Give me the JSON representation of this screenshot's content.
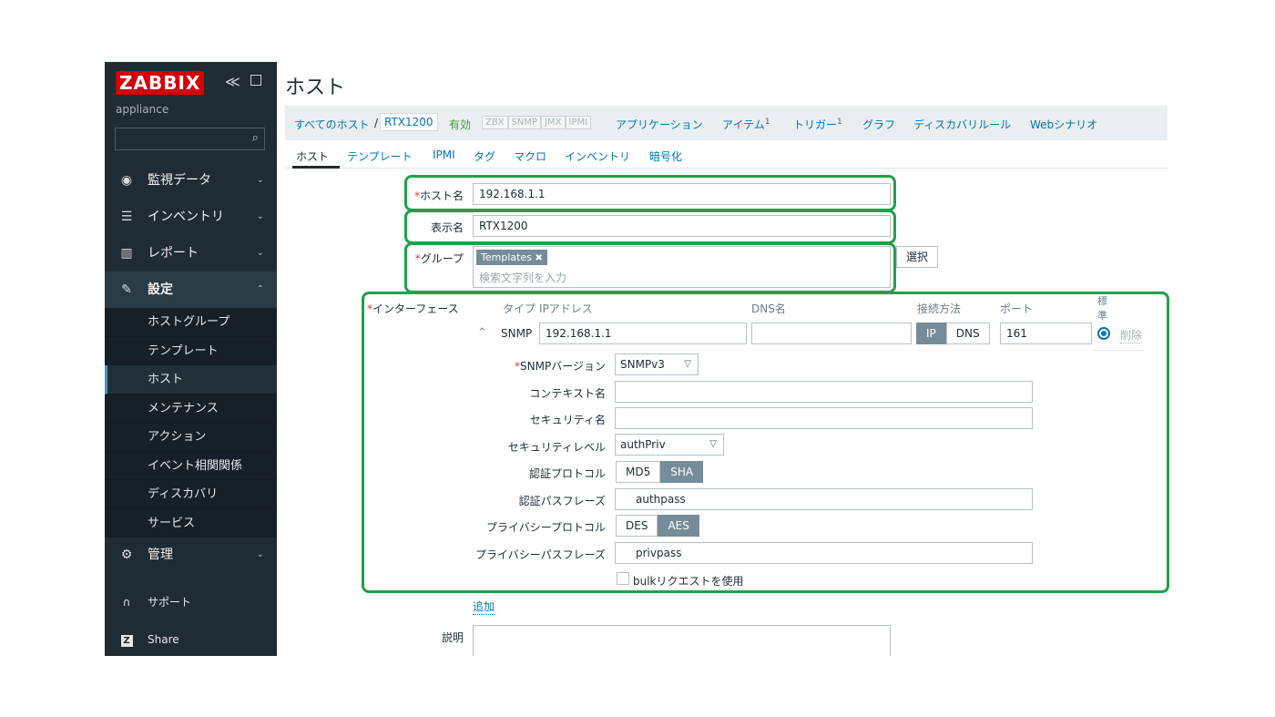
{
  "sidebar": {
    "logo": "ZABBIX",
    "collapse_icon": "≪",
    "server_name": "appliance",
    "menu": [
      {
        "label": "監視データ",
        "icon": "eye-icon"
      },
      {
        "label": "インベントリ",
        "icon": "list-icon"
      },
      {
        "label": "レポート",
        "icon": "bar-chart-icon"
      },
      {
        "label": "設定",
        "icon": "wrench-icon"
      },
      {
        "label": "管理",
        "icon": "gear-icon"
      }
    ],
    "config_items": [
      "ホストグループ",
      "テンプレート",
      "ホスト",
      "メンテナンス",
      "アクション",
      "イベント相関関係",
      "ディスカバリ",
      "サービス"
    ],
    "support": "サポート",
    "share": "Share",
    "share_badge": "Z"
  },
  "page": {
    "title": "ホスト"
  },
  "nav": {
    "all_hosts": "すべてのホスト",
    "separator": "/",
    "current_host": "RTX1200",
    "status": "有効",
    "availability": [
      "ZBX",
      "SNMP",
      "JMX",
      "IPMI"
    ],
    "links": [
      "アプリケーション",
      "アイテム",
      "トリガー",
      "グラフ",
      "ディスカバリルール",
      "Webシナリオ"
    ],
    "items_count": "1",
    "triggers_count": "1"
  },
  "tabs": [
    "ホスト",
    "テンプレート",
    "IPMI",
    "タグ",
    "マクロ",
    "インベントリ",
    "暗号化"
  ],
  "form": {
    "required_mark": "*",
    "host_name_label": "ホスト名",
    "host_name": "192.168.1.1",
    "visible_name_label": "表示名",
    "visible_name": "RTX1200",
    "groups_label": "グループ",
    "group_tag": "Templates",
    "group_remove": "✖",
    "group_placeholder": "検索文字列を入力",
    "select_button": "選択",
    "interfaces_label": "インターフェース",
    "iface_headers": {
      "type": "タイプ",
      "ip": "IPアドレス",
      "dns": "DNS名",
      "connect": "接続方法",
      "port": "ポート",
      "default_1": "標",
      "default_2": "準"
    },
    "iface_type": "SNMP",
    "iface_ip": "192.168.1.1",
    "iface_dns": "",
    "connect_ip": "IP",
    "connect_dns": "DNS",
    "iface_port": "161",
    "remove": "削除",
    "snmp_version_label": "SNMPバージョン",
    "snmp_version": "SNMPv3",
    "context_name_label": "コンテキスト名",
    "context_name": "",
    "security_name_label": "セキュリティ名",
    "security_name": "",
    "security_level_label": "セキュリティレベル",
    "security_level": "authPriv",
    "auth_protocol_label": "認証プロトコル",
    "auth_md5": "MD5",
    "auth_sha": "SHA",
    "auth_pass_label": "認証パスフレーズ",
    "auth_pass": "authpass",
    "priv_protocol_label": "プライバシープロトコル",
    "priv_des": "DES",
    "priv_aes": "AES",
    "priv_pass_label": "プライバシーパスフレーズ",
    "priv_pass": "privpass",
    "bulk_label": "bulkリクエストを使用",
    "add_link": "追加",
    "description_label": "説明"
  },
  "colors": {
    "highlight": "#1fa14a",
    "sidebar": "#1f2c33",
    "link": "#0275b8",
    "logo": "#d40000"
  }
}
